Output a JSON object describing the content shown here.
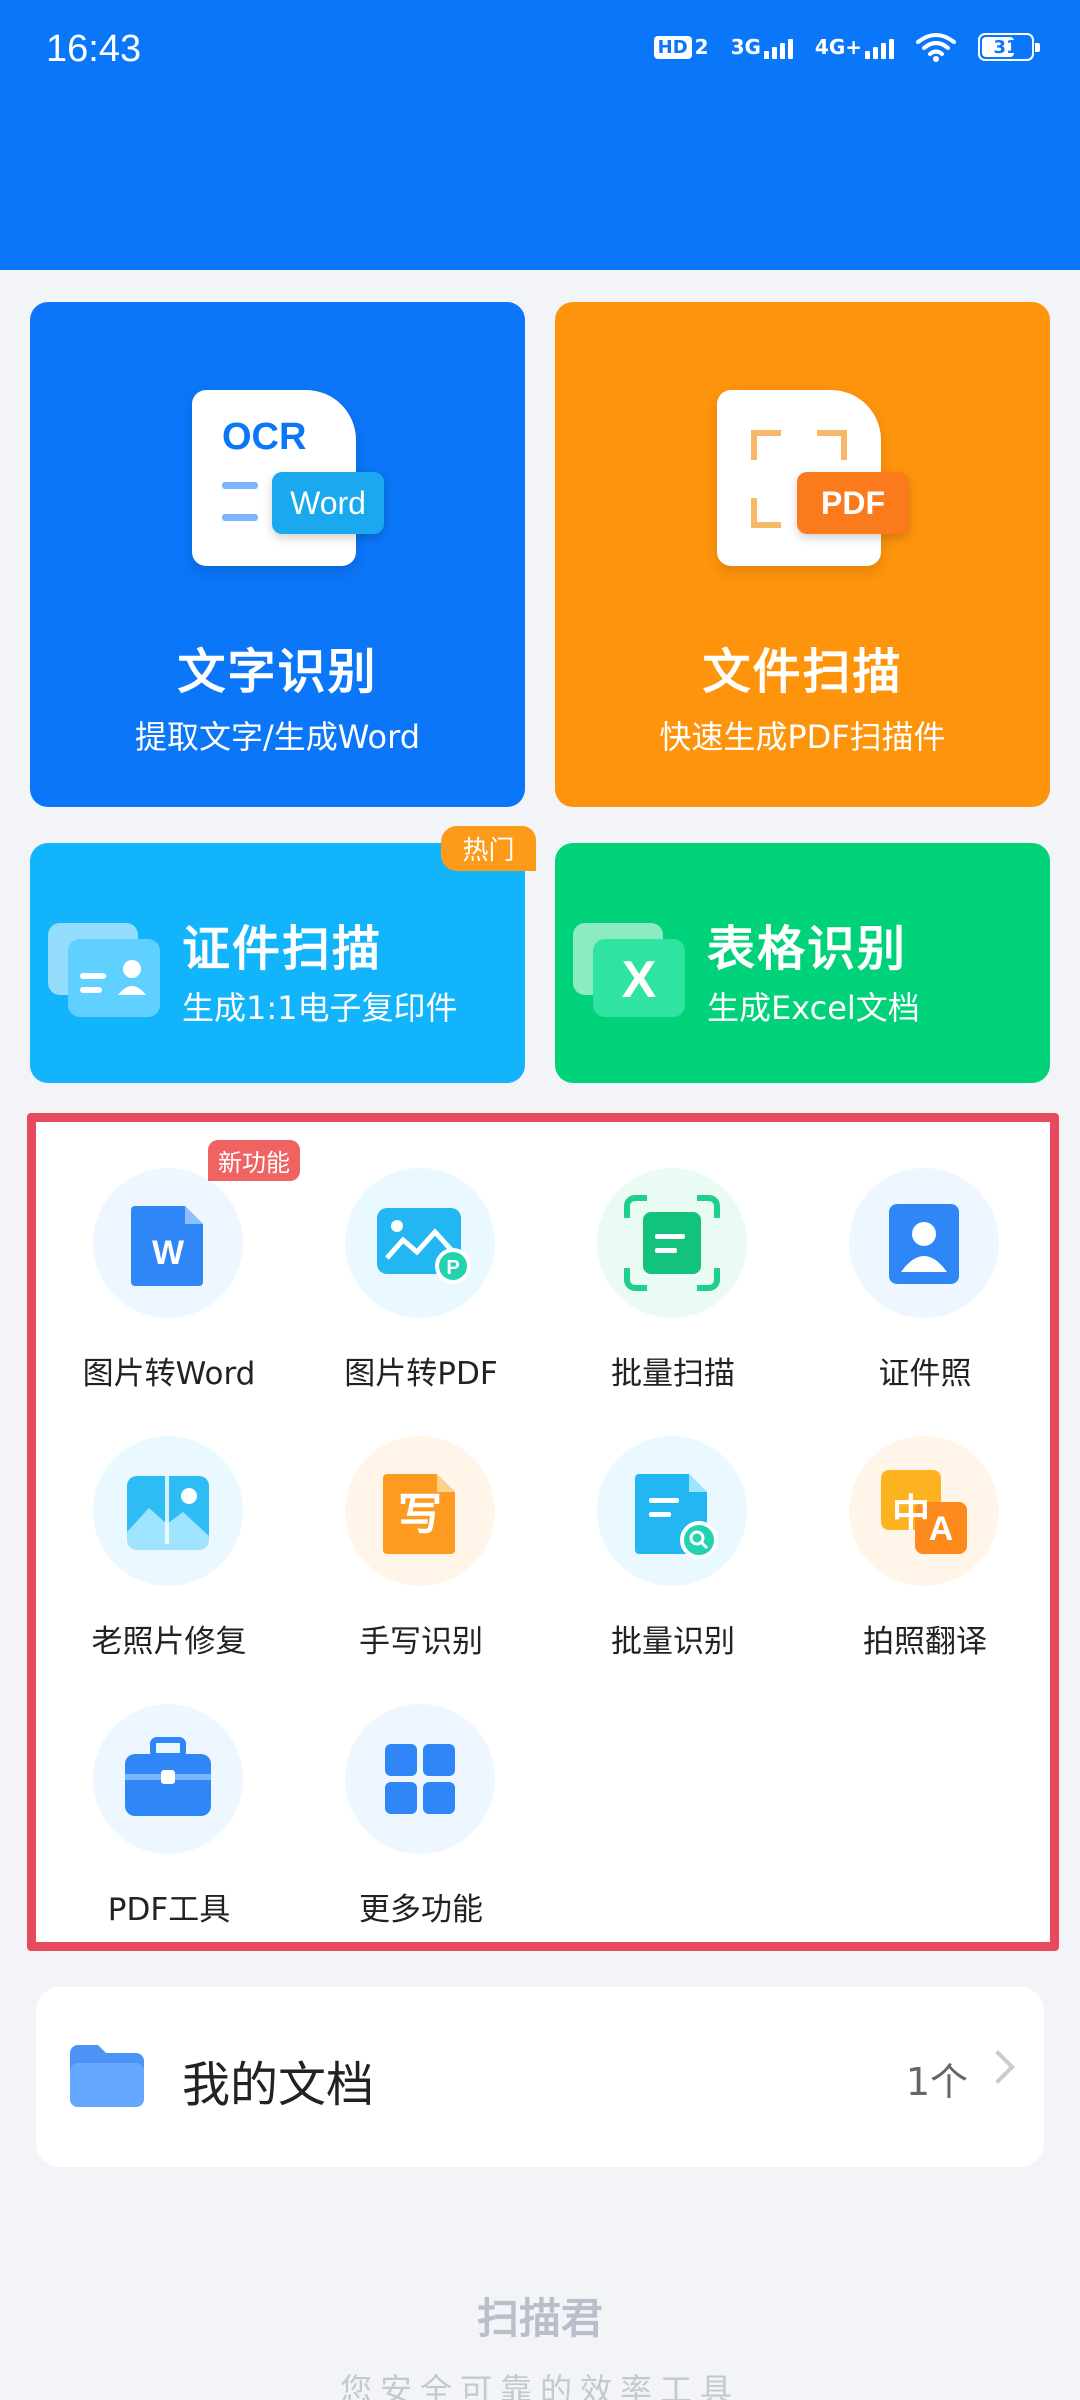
{
  "status": {
    "time": "16:43",
    "hd": "HD",
    "hd_sub": "2",
    "net1": "3G",
    "net2": "4G+",
    "battery": "31"
  },
  "main_cards": {
    "ocr": {
      "title": "文字识别",
      "subtitle": "提取文字/生成Word",
      "icon_text": "OCR",
      "tag": "Word"
    },
    "scan": {
      "title": "文件扫描",
      "subtitle": "快速生成PDF扫描件",
      "tag": "PDF"
    }
  },
  "secondary_cards": {
    "id_scan": {
      "title": "证件扫描",
      "subtitle": "生成1:1电子复印件",
      "badge": "热门"
    },
    "sheet": {
      "title": "表格识别",
      "subtitle": "生成Excel文档",
      "icon_letter": "X"
    }
  },
  "tools": [
    {
      "label": "图片转Word",
      "icon": "word-doc-icon",
      "badge": "新功能"
    },
    {
      "label": "图片转PDF",
      "icon": "image-pdf-icon"
    },
    {
      "label": "批量扫描",
      "icon": "batch-scan-icon"
    },
    {
      "label": "证件照",
      "icon": "id-photo-icon"
    },
    {
      "label": "老照片修复",
      "icon": "photo-restore-icon"
    },
    {
      "label": "手写识别",
      "icon": "handwriting-icon",
      "icon_text": "写"
    },
    {
      "label": "批量识别",
      "icon": "batch-recognize-icon"
    },
    {
      "label": "拍照翻译",
      "icon": "translate-icon",
      "icon_text_cn": "中",
      "icon_text_en": "A"
    },
    {
      "label": "PDF工具",
      "icon": "briefcase-icon"
    },
    {
      "label": "更多功能",
      "icon": "grid-icon"
    }
  ],
  "documents": {
    "title": "我的文档",
    "count": "1个"
  },
  "footer": {
    "brand": "扫描君",
    "slogan": "您安全可靠的效率工具"
  },
  "colors": {
    "header_blue": "#0a76fa",
    "ocr_blue": "#0b76f8",
    "scan_orange": "#fe940c",
    "id_cyan": "#12b4fb",
    "sheet_green": "#00d27a",
    "highlight_red": "#e54b5d"
  }
}
